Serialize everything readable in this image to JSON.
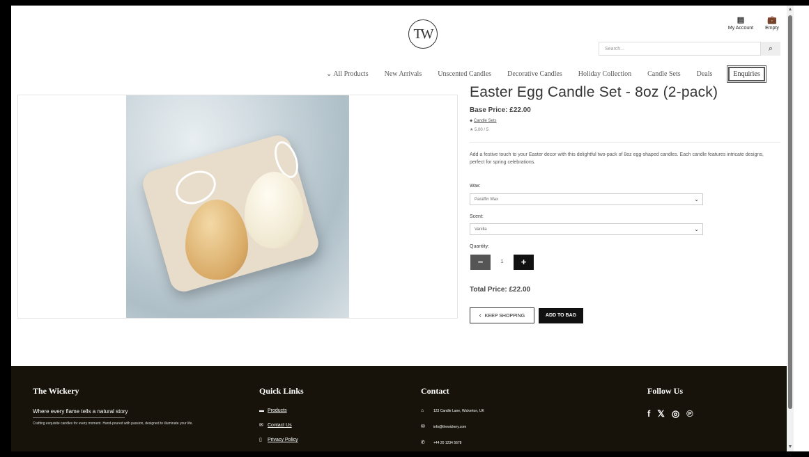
{
  "header": {
    "logo_text": "TW",
    "my_account_label": "My Account",
    "bag_label": "Empty",
    "search_placeholder": "Search...",
    "search_icon": "magnifier-icon"
  },
  "nav": {
    "items": [
      "All Products",
      "New Arrivals",
      "Unscented Candles",
      "Decorative Candles",
      "Holiday Collection",
      "Candle Sets",
      "Deals",
      "Enquiries"
    ]
  },
  "product": {
    "title": "Easter Egg Candle Set - 8oz (2-pack)",
    "base_price": "Base Price: £22.00",
    "category": "Candle Sets",
    "rating": "5.00 / 5",
    "description": "Add a festive touch to your Easter decor with this delightful two-pack of 8oz egg-shaped candles. Each candle features intricate designs, perfect for spring celebrations.",
    "wax_label": "Wax:",
    "wax_value": "Paraffin Wax",
    "scent_label": "Scent:",
    "scent_value": "Vanilla",
    "quantity_label": "Quantity:",
    "quantity_value": "1",
    "total_price": "Total Price: £22.00",
    "keep_shopping_label": "KEEP SHOPPING",
    "add_to_bag_label": "ADD TO BAG"
  },
  "footer": {
    "brand_title": "The Wickery",
    "tagline": "Where every flame tells a natural story",
    "blurb": "Crafting exquisite candles for every moment. Hand-poured with passion, designed to illuminate your life.",
    "quick_links_title": "Quick Links",
    "links": [
      "Products",
      "Contact Us",
      "Privacy Policy"
    ],
    "contact_title": "Contact",
    "address": "123 Candle Lane, Wickerton, UK",
    "email": "info@thewickery.com",
    "phone": "+44 20 1234 5678",
    "follow_title": "Follow Us"
  },
  "colors": {
    "footer_bg": "#17130a",
    "button_dark": "#111111",
    "minus_button": "#555555"
  }
}
